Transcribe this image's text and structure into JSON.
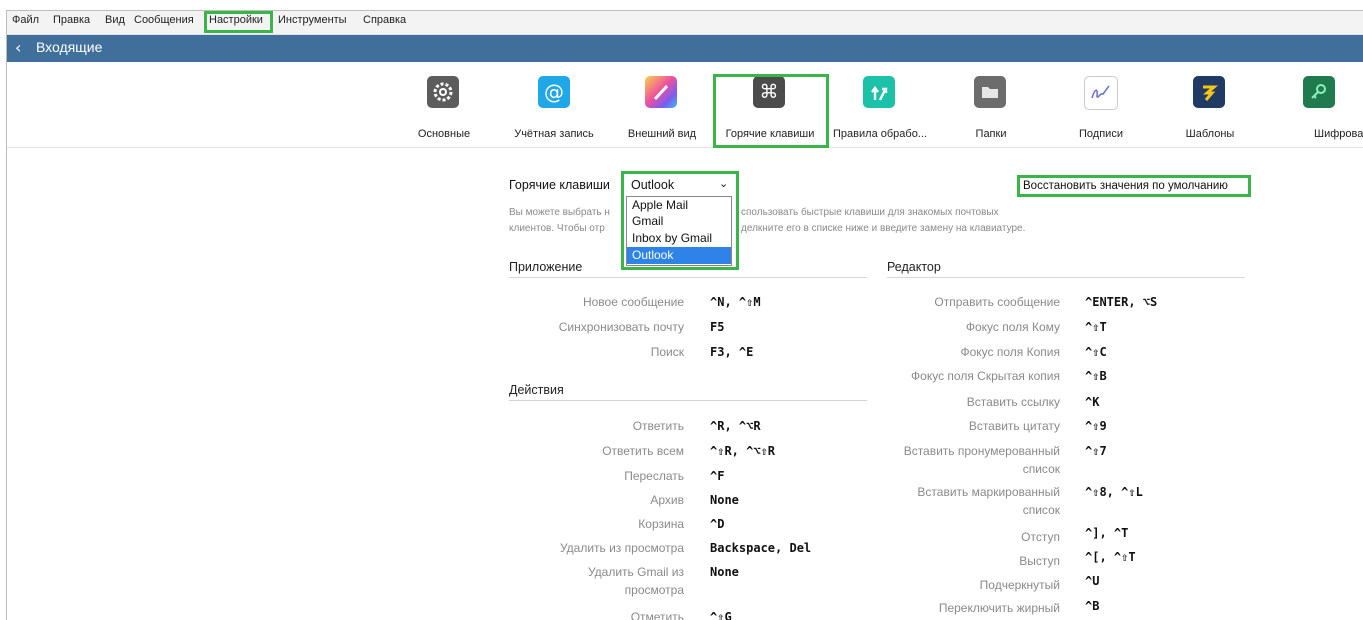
{
  "menubar": {
    "items": [
      "Файл",
      "Правка",
      "Вид",
      "Сообщения",
      "Настройки",
      "Инструменты",
      "Справка"
    ]
  },
  "nav": {
    "back_icon": "chevron-left-icon",
    "title": "Входящие"
  },
  "toolbar": {
    "items": [
      {
        "label": "Основные",
        "icon": "gear-icon"
      },
      {
        "label": "Учётная запись",
        "icon": "at-sign-icon"
      },
      {
        "label": "Внешний вид",
        "icon": "palette-icon"
      },
      {
        "label": "Горячие клавиши",
        "icon": "command-key-icon"
      },
      {
        "label": "Правила обрабо...",
        "icon": "rules-arrows-icon"
      },
      {
        "label": "Папки",
        "icon": "folder-icon"
      },
      {
        "label": "Подписи",
        "icon": "signature-icon"
      },
      {
        "label": "Шаблоны",
        "icon": "template-icon"
      },
      {
        "label": "Шифрование и Э",
        "icon": "key-icon"
      }
    ],
    "selected": "Горячие клавиши"
  },
  "shortcuts": {
    "label": "Горячие клавиши",
    "selected": "Outlook",
    "options": [
      "Apple Mail",
      "Gmail",
      "Inbox by Gmail",
      "Outlook"
    ],
    "restore_label": "Восстановить значения по умолчанию",
    "desc_line1_a": "Вы можете выбрать н",
    "desc_line1_b": "спользовать быстрые клавиши для знакомых почтовых",
    "desc_line2_a": "клиентов. Чтобы отр",
    "desc_line2_b": "делкните его в списке ниже и введите замену на клавиатуре."
  },
  "sections": {
    "app": {
      "title": "Приложение",
      "rows": [
        {
          "label": "Новое сообщение",
          "keys": "^N, ^⇧M"
        },
        {
          "label": "Синхронизовать почту",
          "keys": "F5"
        },
        {
          "label": "Поиск",
          "keys": "F3, ^E"
        }
      ]
    },
    "actions": {
      "title": "Действия",
      "rows": [
        {
          "label": "Ответить",
          "keys": "^R, ^⌥R"
        },
        {
          "label": "Ответить всем",
          "keys": "^⇧R, ^⌥⇧R"
        },
        {
          "label": "Переслать",
          "keys": "^F"
        },
        {
          "label": "Архив",
          "keys": "None"
        },
        {
          "label": "Корзина",
          "keys": "^D"
        },
        {
          "label": "Удалить из просмотра",
          "keys": "Backspace, Del"
        },
        {
          "label_l1": "Удалить Gmail из",
          "label_l2": "просмотра",
          "keys": "None"
        },
        {
          "label": "Отметить",
          "keys": "^⇧G"
        }
      ]
    },
    "editor": {
      "title": "Редактор",
      "rows": [
        {
          "label": "Отправить сообщение",
          "keys": "^ENTER, ⌥S"
        },
        {
          "label": "Фокус поля Кому",
          "keys": "^⇧T"
        },
        {
          "label": "Фокус поля Копия",
          "keys": "^⇧C"
        },
        {
          "label": "Фокус поля Скрытая копия",
          "keys": "^⇧B"
        },
        {
          "label": "Вставить ссылку",
          "keys": "^K"
        },
        {
          "label": "Вставить цитату",
          "keys": "^⇧9"
        },
        {
          "label_l1": "Вставить пронумерованный",
          "label_l2": "список",
          "keys": "^⇧7"
        },
        {
          "label_l1": "Вставить маркированный",
          "label_l2": "список",
          "keys": "^⇧8, ^⇧L"
        },
        {
          "label": "Отступ",
          "keys": "^], ^T"
        },
        {
          "label": "Выступ",
          "keys": "^[, ^⇧T"
        },
        {
          "label": "Подчеркнутый",
          "keys": "^U"
        },
        {
          "label": "Переключить жирный",
          "keys": "^B"
        }
      ]
    }
  },
  "colors": {
    "nav_bg": "#3f6f9a",
    "highlight": "#3ab54a",
    "dropdown_selected": "#2f82e8"
  }
}
